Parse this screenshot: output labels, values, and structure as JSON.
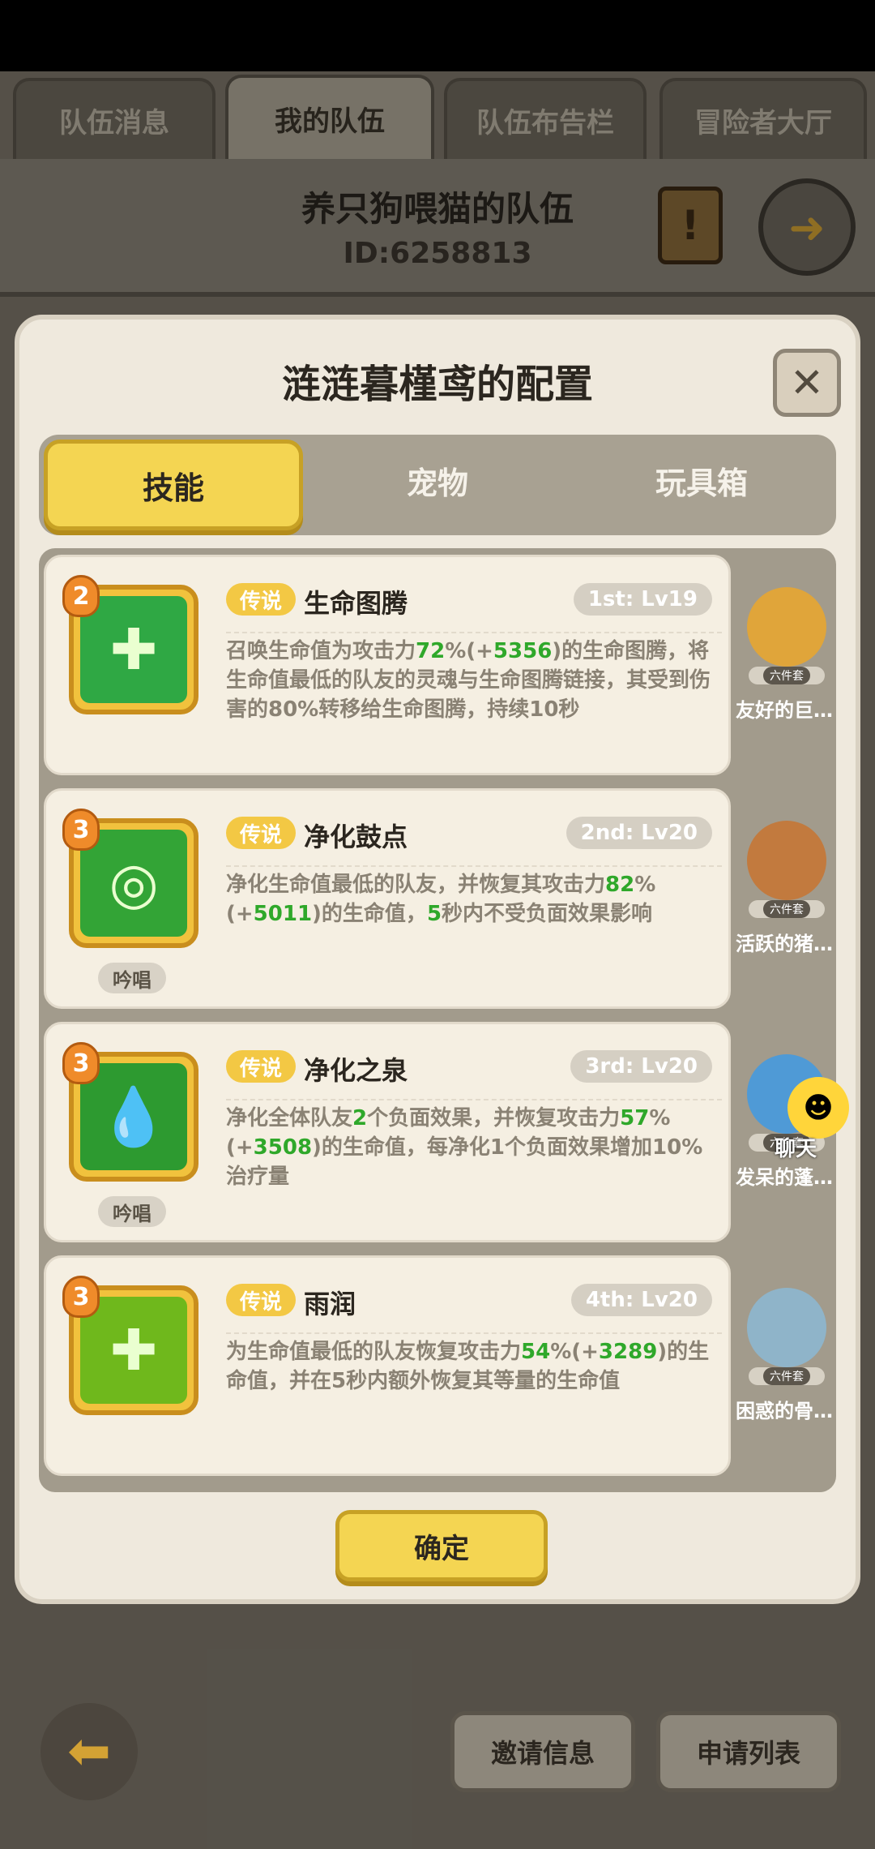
{
  "top_tabs": [
    {
      "label": "队伍消息",
      "active": false
    },
    {
      "label": "我的队伍",
      "active": true
    },
    {
      "label": "队伍布告栏",
      "active": false
    },
    {
      "label": "冒险者大厅",
      "active": false
    }
  ],
  "team": {
    "name": "养只狗喂猫的队伍",
    "id": "ID:6258813"
  },
  "modal": {
    "title": "涟涟暮槿鸢的配置",
    "close_icon": "close-icon",
    "tabs": [
      {
        "label": "技能",
        "active": true
      },
      {
        "label": "宠物",
        "active": false
      },
      {
        "label": "玩具箱",
        "active": false
      }
    ],
    "skills": [
      {
        "badge": "2",
        "rarity": "传说",
        "name": "生命图腾",
        "level": "1st: Lv19",
        "chant": "",
        "desc": [
          "召唤生命值为攻击力",
          "72",
          "%(+",
          "5356",
          ")的生命图腾，将生命值最低的队友的灵魂与生命图腾链接，其受到伤害的80%转移给生命图腾，持续10秒"
        ],
        "icon_color": "#2fa844"
      },
      {
        "badge": "3",
        "rarity": "传说",
        "name": "净化鼓点",
        "level": "2nd: Lv20",
        "chant": "吟唱",
        "desc": [
          "净化生命值最低的队友，并恢复其攻击力",
          "82",
          "%(+",
          "5011",
          ")的生命值，",
          "5",
          "秒内不受负面效果影响"
        ],
        "icon_color": "#33a436"
      },
      {
        "badge": "3",
        "rarity": "传说",
        "name": "净化之泉",
        "level": "3rd: Lv20",
        "chant": "吟唱",
        "desc": [
          "净化全体队友",
          "2",
          "个负面效果，并恢复攻击力",
          "57",
          "%(+",
          "3508",
          ")的生命值，每净化1个负面效果增加10%治疗量"
        ],
        "icon_color": "#2d9a30"
      },
      {
        "badge": "3",
        "rarity": "传说",
        "name": "雨润",
        "level": "4th: Lv20",
        "chant": "",
        "desc": [
          "为生命值最低的队友恢复攻击力",
          "54",
          "%(+",
          "3289",
          ")的生命值，并在5秒内额外恢复其等量的生命值"
        ],
        "icon_color": "#6fb81c"
      }
    ],
    "pets": [
      {
        "name": "友好的巨…",
        "set_tag": "六件套",
        "color": "#e0a53a"
      },
      {
        "name": "活跃的猪…",
        "set_tag": "六件套",
        "color": "#c27a3e"
      },
      {
        "name": "发呆的蓬…",
        "set_tag": "六件套",
        "color": "#4f9ad6"
      },
      {
        "name": "困惑的骨…",
        "set_tag": "六件套",
        "color": "#8fb4c9"
      }
    ],
    "confirm_label": "确定"
  },
  "chat": {
    "label": "聊天"
  },
  "bottom": {
    "invite_label": "邀请信息",
    "apply_label": "申请列表"
  }
}
